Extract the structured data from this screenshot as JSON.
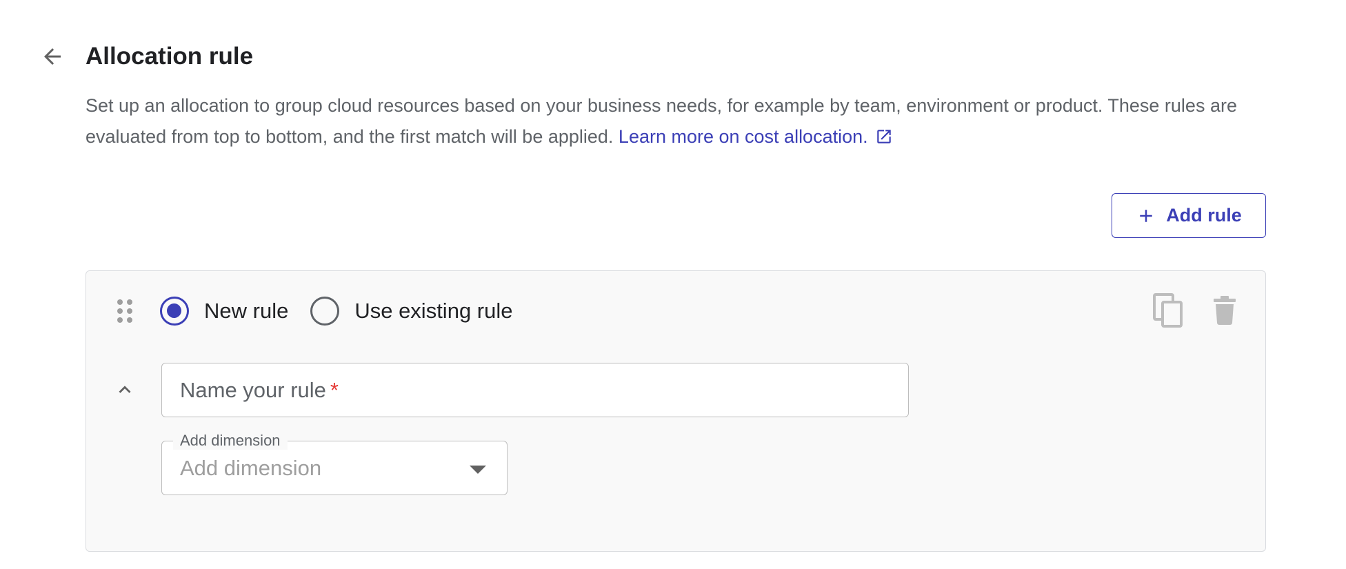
{
  "header": {
    "back_icon": "arrow-back-icon",
    "title": "Allocation rule"
  },
  "description": {
    "text": "Set up an allocation to group cloud resources based on your business needs, for example by team, environment or product. These rules are evaluated from top to bottom, and the first match will be applied. ",
    "link_text": "Learn more on cost allocation.",
    "link_icon": "open-in-new-icon"
  },
  "toolbar": {
    "add_rule_icon": "plus-icon",
    "add_rule_label": "Add rule"
  },
  "rule_card": {
    "drag_icon": "drag-handle-icon",
    "radio_options": [
      {
        "label": "New rule",
        "checked": true
      },
      {
        "label": "Use existing rule",
        "checked": false
      }
    ],
    "copy_icon": "copy-icon",
    "delete_icon": "trash-icon",
    "collapse_icon": "chevron-up-icon",
    "name_input": {
      "placeholder": "Name your rule",
      "required_marker": "*"
    },
    "dimension_select": {
      "label": "Add dimension",
      "placeholder": "Add dimension",
      "caret_icon": "caret-down-icon"
    }
  },
  "colors": {
    "accent": "#3b3fb6",
    "text_primary": "#202124",
    "text_secondary": "#5f6368",
    "card_background": "#f9f9f9",
    "border": "#bdbdbd",
    "required": "#e53935"
  }
}
